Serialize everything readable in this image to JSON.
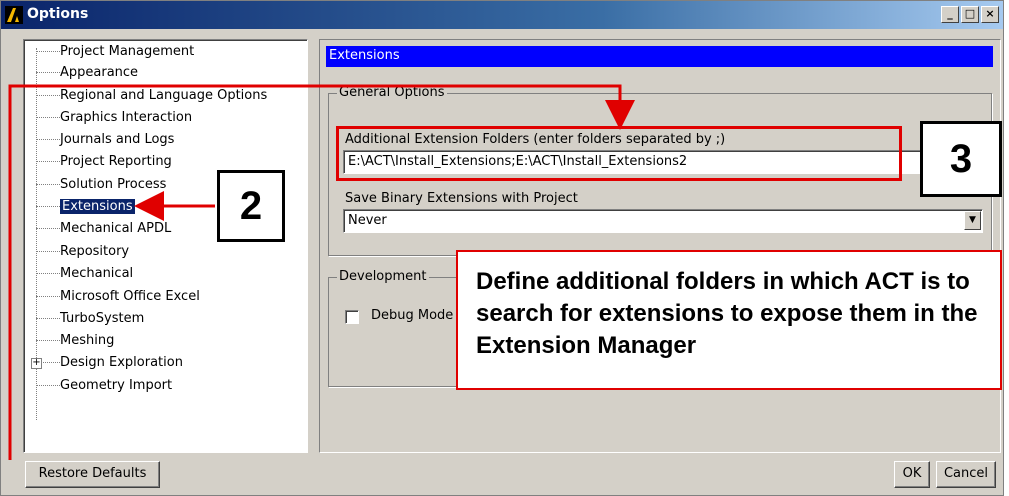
{
  "window": {
    "title": "Options",
    "minimize": "_",
    "maximize": "□",
    "close": "×"
  },
  "tree": {
    "items": [
      "Project Management",
      "Appearance",
      "Regional and Language Options",
      "Graphics Interaction",
      "Journals and Logs",
      "Project Reporting",
      "Solution Process",
      "Extensions",
      "Mechanical APDL",
      "Repository",
      "Mechanical",
      "Microsoft Office Excel",
      "TurboSystem",
      "Meshing",
      "Design Exploration",
      "Geometry Import"
    ],
    "selected": "Extensions",
    "expander": "+"
  },
  "panel": {
    "header": "Extensions",
    "general": {
      "title": "General Options",
      "folders_label": "Additional Extension Folders (enter folders separated by ;)",
      "folders_value": "E:\\ACT\\Install_Extensions;E:\\ACT\\Install_Extensions2",
      "binary_label": "Save Binary Extensions with Project",
      "binary_value": "Never"
    },
    "development": {
      "title": "Development",
      "debug_label": "Debug Mode"
    }
  },
  "buttons": {
    "restore": "Restore Defaults",
    "ok": "OK",
    "cancel": "Cancel"
  },
  "annotations": {
    "step2": "2",
    "step3": "3",
    "callout": "Define additional folders in which ACT is to search for extensions to expose them in the Extension Manager",
    "color": "#e00000"
  }
}
